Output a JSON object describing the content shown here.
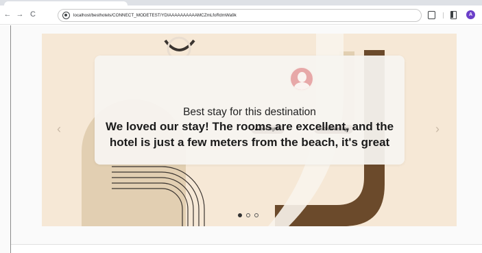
{
  "browser": {
    "url": "localhost/besthotels/CONNECT_MODETEST/YDIAAAAAAAAAAMCZmLfoRdmWa9k",
    "profile_initial": "A",
    "back_icon": "←",
    "forward_icon": "→",
    "reload_icon": "C"
  },
  "carousel": {
    "prev_icon": "‹",
    "next_icon": "›",
    "slide_count": 3,
    "active_slide": 1
  },
  "review": {
    "title": "Best stay for this destination",
    "nights_icon": "bed-icon",
    "nights_label": "x 4 nights",
    "time_icon": "calendar-icon",
    "time_label": "3 weeks ago",
    "quote": "We loved our stay! The rooms are excellent, and the hotel is just a few meters from the beach, it's great"
  },
  "colors": {
    "banner_bg": "#f6e8d6",
    "accent_brown": "#6b4a2b",
    "avatar_pink": "#e7a8a8",
    "profile_purple": "#6b3fc9"
  }
}
